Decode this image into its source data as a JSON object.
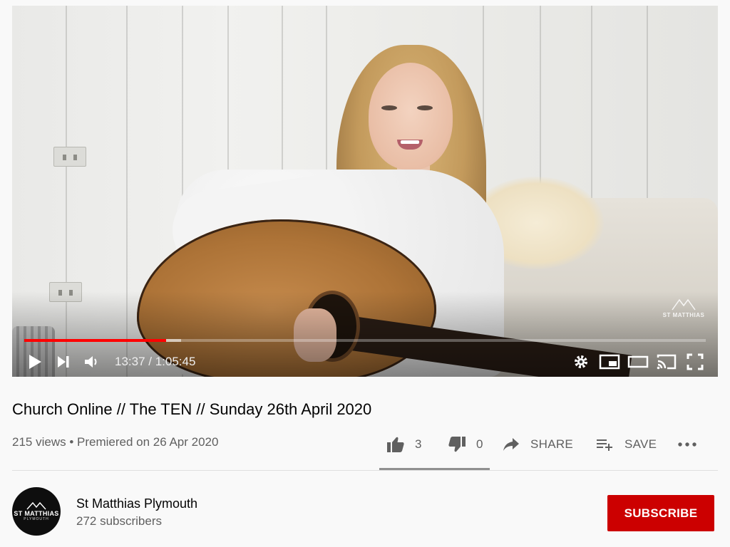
{
  "player": {
    "time_current": "13:37",
    "time_duration": "1:05:45",
    "time_display": "13:37 / 1:05:45",
    "progress_fraction": 0.208,
    "buffer_fraction": 0.23,
    "accent_color": "#ff0000",
    "watermark_text": "ST MATTHIAS",
    "icons": [
      "play-icon",
      "next-icon",
      "volume-icon",
      "settings-icon",
      "miniplayer-icon",
      "theater-icon",
      "cast-icon",
      "fullscreen-icon"
    ]
  },
  "video": {
    "title": "Church Online // The TEN // Sunday 26th April 2020",
    "meta": "215 views • Premiered on 26 Apr 2020"
  },
  "actions": {
    "like_count": "3",
    "dislike_count": "0",
    "share_label": "SHARE",
    "save_label": "SAVE",
    "like_fraction": 1.0
  },
  "channel": {
    "avatar_text": "ST MATTHIAS",
    "avatar_subtext": "PLYMOUTH",
    "name": "St Matthias Plymouth",
    "subscribers": "272 subscribers",
    "subscribe_label": "SUBSCRIBE",
    "subscribe_color": "#cc0000"
  }
}
